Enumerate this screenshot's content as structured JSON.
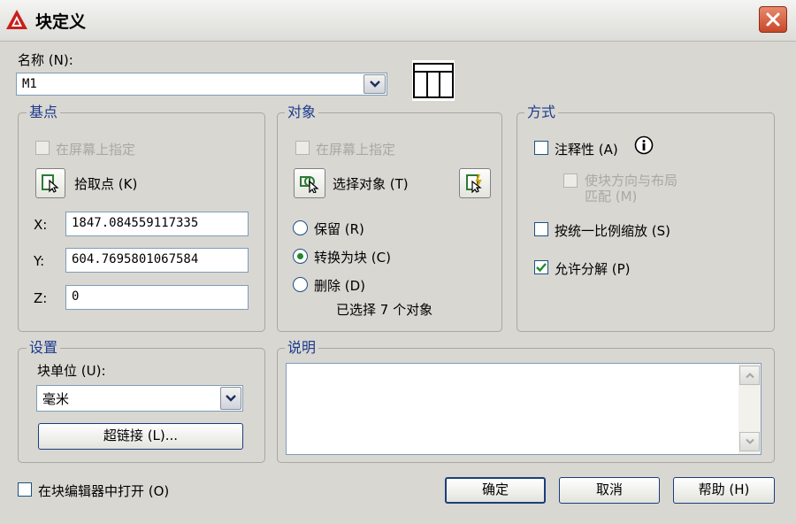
{
  "window": {
    "title": "块定义",
    "close_icon": "close-icon"
  },
  "name": {
    "label": "名称 (N):",
    "value": "M1",
    "preview_icon": "block-preview-icon"
  },
  "base_point": {
    "title": "基点",
    "specify_onscreen": "在屏幕上指定",
    "pick_point": "拾取点 (K)",
    "x_label": "X:",
    "x_value": "1847.084559117335",
    "y_label": "Y:",
    "y_value": "604.7695801067584",
    "z_label": "Z:",
    "z_value": "0"
  },
  "objects": {
    "title": "对象",
    "specify_onscreen": "在屏幕上指定",
    "select_objects": "选择对象 (T)",
    "retain": "保留 (R)",
    "convert_to_block": "转换为块 (C)",
    "delete": "删除 (D)",
    "selected_count": "已选择 7 个对象",
    "selected_option": "convert_to_block"
  },
  "behavior": {
    "title": "方式",
    "annotative": "注释性 (A)",
    "match_orientation_line1": "使块方向与布局",
    "match_orientation_line2": "匹配 (M)",
    "scale_uniformly": "按统一比例缩放 (S)",
    "allow_exploding": "允许分解 (P)",
    "allow_exploding_checked": true,
    "info_icon": "info-icon"
  },
  "settings": {
    "title": "设置",
    "block_unit_label": "块单位 (U):",
    "block_unit_value": "毫米",
    "hyperlink": "超链接 (L)..."
  },
  "description": {
    "title": "说明",
    "value": ""
  },
  "footer": {
    "open_in_editor": "在块编辑器中打开 (O)",
    "ok": "确定",
    "cancel": "取消",
    "help": "帮助 (H)"
  }
}
